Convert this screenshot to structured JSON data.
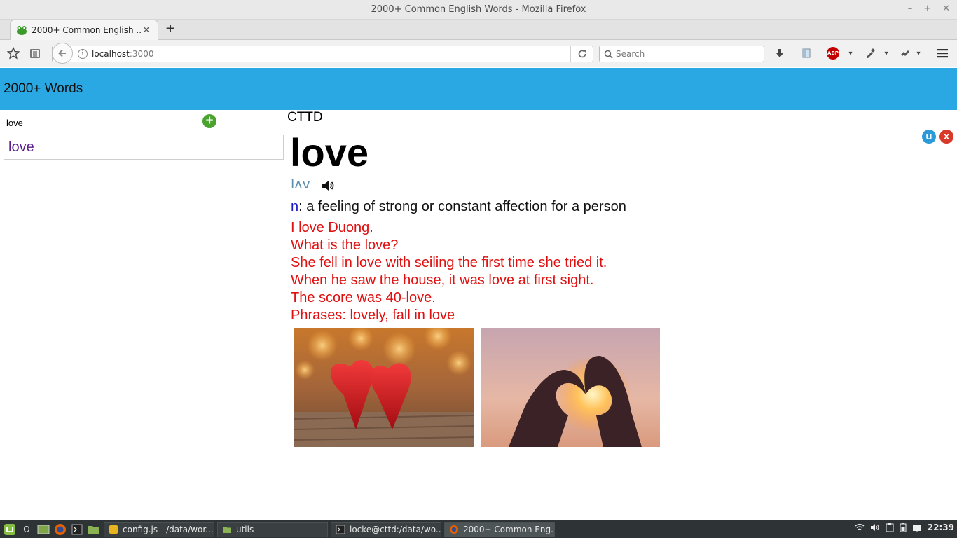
{
  "window": {
    "title": "2000+ Common English Words - Mozilla Firefox",
    "controls": [
      "–",
      "+",
      "✕"
    ]
  },
  "tabs": [
    {
      "label": "2000+ Common English ...",
      "close": "✕"
    }
  ],
  "newtab_label": "+",
  "toolbar": {
    "url_host": "localhost",
    "url_port": ":3000",
    "search_placeholder": "Search",
    "info_glyph": "i",
    "abp_label": "ABP"
  },
  "header": {
    "brand": "2000+ Words"
  },
  "sidebar": {
    "search_value": "love",
    "add_label": "+",
    "words": [
      {
        "word": "love"
      }
    ]
  },
  "entry": {
    "source": "CTTD",
    "word": "love",
    "pronunciation": "lʌv",
    "pos": "n",
    "definition": ": a feeling of strong or constant affection for a person",
    "examples": [
      "I love Duong.",
      "What is the love?",
      "She fell in love with seiling the first time she tried it.",
      "When he saw the house, it was love at first sight.",
      "The score was 40-love.",
      "Phrases: lovely, fall in love"
    ],
    "update_label": "u",
    "delete_label": "x"
  },
  "taskbar": {
    "tasks": [
      {
        "label": "config.js - /data/wor..."
      },
      {
        "label": "utils"
      },
      {
        "label": "locke@cttd:/data/wo..."
      },
      {
        "label": "2000+ Common Eng..."
      }
    ],
    "clock": "22:39",
    "launcher_omega": "Ω"
  },
  "colors": {
    "header_bg": "#29a8e3",
    "word_link": "#5a1e8c",
    "example_text": "#e01010",
    "pos_text": "#1a1ac8",
    "pron_text": "#5d8fb3",
    "add_button": "#4aa32d",
    "update_button": "#2a9ad8",
    "delete_button": "#d83a2a"
  }
}
